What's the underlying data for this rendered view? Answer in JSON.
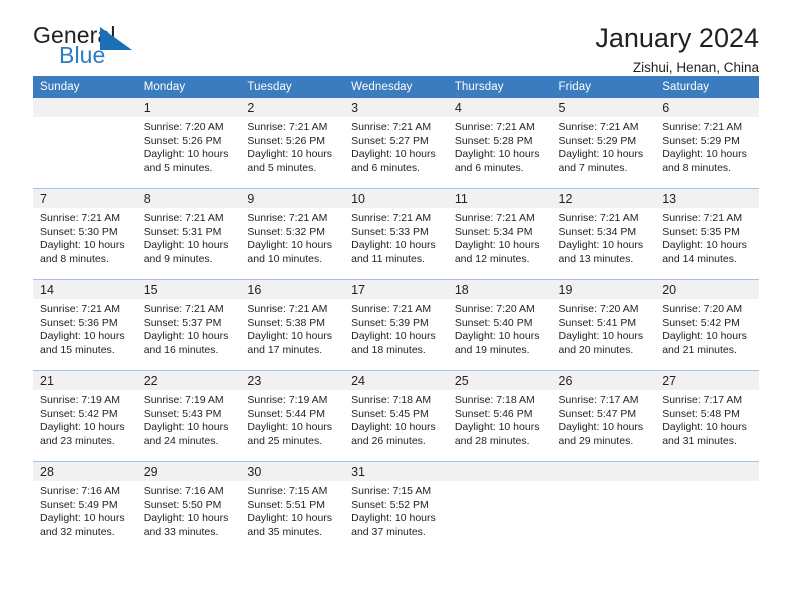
{
  "brand": {
    "name_top": "General",
    "name_bottom": "Blue",
    "sail_icon": "sail-triangle-icon",
    "top_color": "#231f20",
    "bottom_color": "#2b7cc2"
  },
  "header": {
    "title": "January 2024",
    "subtitle": "Zishui, Henan, China"
  },
  "theme": {
    "header_bg": "#3a7cbe",
    "header_text": "#ffffff",
    "daynum_band_bg": "#f1f1f1",
    "cell_bg": "#ffffff",
    "row_divider": "#a7c3e0",
    "text": "#231f20"
  },
  "calendar": {
    "weekday_headers": [
      "Sunday",
      "Monday",
      "Tuesday",
      "Wednesday",
      "Thursday",
      "Friday",
      "Saturday"
    ],
    "weeks": [
      [
        {
          "day": "",
          "empty": true,
          "lines": []
        },
        {
          "day": "1",
          "lines": [
            "Sunrise: 7:20 AM",
            "Sunset: 5:26 PM",
            "Daylight: 10 hours",
            "and 5 minutes."
          ]
        },
        {
          "day": "2",
          "lines": [
            "Sunrise: 7:21 AM",
            "Sunset: 5:26 PM",
            "Daylight: 10 hours",
            "and 5 minutes."
          ]
        },
        {
          "day": "3",
          "lines": [
            "Sunrise: 7:21 AM",
            "Sunset: 5:27 PM",
            "Daylight: 10 hours",
            "and 6 minutes."
          ]
        },
        {
          "day": "4",
          "lines": [
            "Sunrise: 7:21 AM",
            "Sunset: 5:28 PM",
            "Daylight: 10 hours",
            "and 6 minutes."
          ]
        },
        {
          "day": "5",
          "lines": [
            "Sunrise: 7:21 AM",
            "Sunset: 5:29 PM",
            "Daylight: 10 hours",
            "and 7 minutes."
          ]
        },
        {
          "day": "6",
          "lines": [
            "Sunrise: 7:21 AM",
            "Sunset: 5:29 PM",
            "Daylight: 10 hours",
            "and 8 minutes."
          ]
        }
      ],
      [
        {
          "day": "7",
          "lines": [
            "Sunrise: 7:21 AM",
            "Sunset: 5:30 PM",
            "Daylight: 10 hours",
            "and 8 minutes."
          ]
        },
        {
          "day": "8",
          "lines": [
            "Sunrise: 7:21 AM",
            "Sunset: 5:31 PM",
            "Daylight: 10 hours",
            "and 9 minutes."
          ]
        },
        {
          "day": "9",
          "lines": [
            "Sunrise: 7:21 AM",
            "Sunset: 5:32 PM",
            "Daylight: 10 hours",
            "and 10 minutes."
          ]
        },
        {
          "day": "10",
          "lines": [
            "Sunrise: 7:21 AM",
            "Sunset: 5:33 PM",
            "Daylight: 10 hours",
            "and 11 minutes."
          ]
        },
        {
          "day": "11",
          "lines": [
            "Sunrise: 7:21 AM",
            "Sunset: 5:34 PM",
            "Daylight: 10 hours",
            "and 12 minutes."
          ]
        },
        {
          "day": "12",
          "lines": [
            "Sunrise: 7:21 AM",
            "Sunset: 5:34 PM",
            "Daylight: 10 hours",
            "and 13 minutes."
          ]
        },
        {
          "day": "13",
          "lines": [
            "Sunrise: 7:21 AM",
            "Sunset: 5:35 PM",
            "Daylight: 10 hours",
            "and 14 minutes."
          ]
        }
      ],
      [
        {
          "day": "14",
          "lines": [
            "Sunrise: 7:21 AM",
            "Sunset: 5:36 PM",
            "Daylight: 10 hours",
            "and 15 minutes."
          ]
        },
        {
          "day": "15",
          "lines": [
            "Sunrise: 7:21 AM",
            "Sunset: 5:37 PM",
            "Daylight: 10 hours",
            "and 16 minutes."
          ]
        },
        {
          "day": "16",
          "lines": [
            "Sunrise: 7:21 AM",
            "Sunset: 5:38 PM",
            "Daylight: 10 hours",
            "and 17 minutes."
          ]
        },
        {
          "day": "17",
          "lines": [
            "Sunrise: 7:21 AM",
            "Sunset: 5:39 PM",
            "Daylight: 10 hours",
            "and 18 minutes."
          ]
        },
        {
          "day": "18",
          "lines": [
            "Sunrise: 7:20 AM",
            "Sunset: 5:40 PM",
            "Daylight: 10 hours",
            "and 19 minutes."
          ]
        },
        {
          "day": "19",
          "lines": [
            "Sunrise: 7:20 AM",
            "Sunset: 5:41 PM",
            "Daylight: 10 hours",
            "and 20 minutes."
          ]
        },
        {
          "day": "20",
          "lines": [
            "Sunrise: 7:20 AM",
            "Sunset: 5:42 PM",
            "Daylight: 10 hours",
            "and 21 minutes."
          ]
        }
      ],
      [
        {
          "day": "21",
          "lines": [
            "Sunrise: 7:19 AM",
            "Sunset: 5:42 PM",
            "Daylight: 10 hours",
            "and 23 minutes."
          ]
        },
        {
          "day": "22",
          "lines": [
            "Sunrise: 7:19 AM",
            "Sunset: 5:43 PM",
            "Daylight: 10 hours",
            "and 24 minutes."
          ]
        },
        {
          "day": "23",
          "lines": [
            "Sunrise: 7:19 AM",
            "Sunset: 5:44 PM",
            "Daylight: 10 hours",
            "and 25 minutes."
          ]
        },
        {
          "day": "24",
          "lines": [
            "Sunrise: 7:18 AM",
            "Sunset: 5:45 PM",
            "Daylight: 10 hours",
            "and 26 minutes."
          ]
        },
        {
          "day": "25",
          "lines": [
            "Sunrise: 7:18 AM",
            "Sunset: 5:46 PM",
            "Daylight: 10 hours",
            "and 28 minutes."
          ]
        },
        {
          "day": "26",
          "lines": [
            "Sunrise: 7:17 AM",
            "Sunset: 5:47 PM",
            "Daylight: 10 hours",
            "and 29 minutes."
          ]
        },
        {
          "day": "27",
          "lines": [
            "Sunrise: 7:17 AM",
            "Sunset: 5:48 PM",
            "Daylight: 10 hours",
            "and 31 minutes."
          ]
        }
      ],
      [
        {
          "day": "28",
          "lines": [
            "Sunrise: 7:16 AM",
            "Sunset: 5:49 PM",
            "Daylight: 10 hours",
            "and 32 minutes."
          ]
        },
        {
          "day": "29",
          "lines": [
            "Sunrise: 7:16 AM",
            "Sunset: 5:50 PM",
            "Daylight: 10 hours",
            "and 33 minutes."
          ]
        },
        {
          "day": "30",
          "lines": [
            "Sunrise: 7:15 AM",
            "Sunset: 5:51 PM",
            "Daylight: 10 hours",
            "and 35 minutes."
          ]
        },
        {
          "day": "31",
          "lines": [
            "Sunrise: 7:15 AM",
            "Sunset: 5:52 PM",
            "Daylight: 10 hours",
            "and 37 minutes."
          ]
        },
        {
          "day": "",
          "empty": true,
          "lines": []
        },
        {
          "day": "",
          "empty": true,
          "lines": []
        },
        {
          "day": "",
          "empty": true,
          "lines": []
        }
      ]
    ]
  }
}
